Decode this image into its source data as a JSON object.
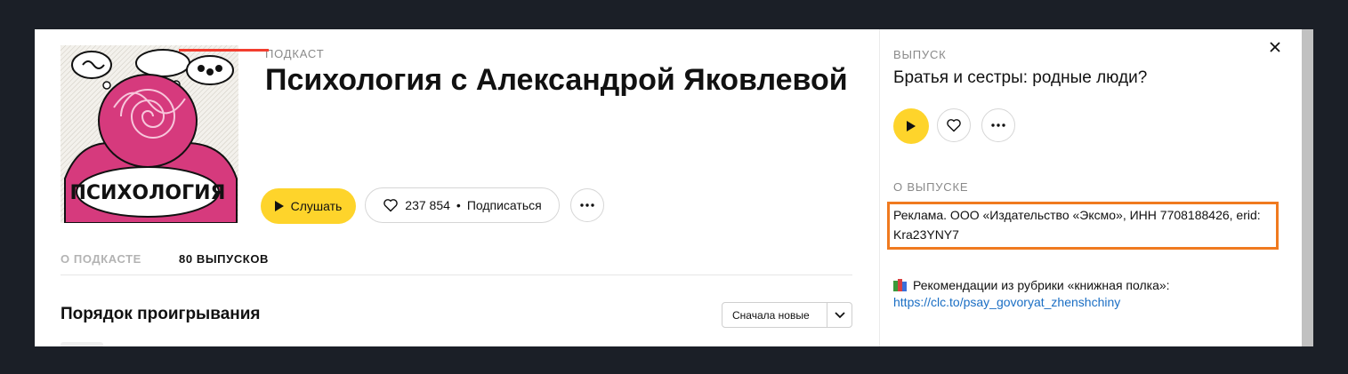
{
  "podcast": {
    "kicker": "ПОДКАСТ",
    "title": "Психология с Александрой Яковлевой",
    "cover_lettering": "ПСИХОЛОГИЯ",
    "listen_label": "Слушать",
    "likes_count": "237 854",
    "separator": "•",
    "subscribe_label": "Подписаться"
  },
  "tabs": [
    {
      "label": "О ПОДКАСТЕ",
      "active": false
    },
    {
      "label": "80 ВЫПУСКОВ",
      "active": true
    }
  ],
  "order": {
    "title": "Порядок проигрывания",
    "sort_value": "Сначала новые"
  },
  "episode_panel": {
    "kicker": "ВЫПУСК",
    "title": "Братья и сестры: родные люди?",
    "about_kicker": "О ВЫПУСКЕ",
    "description": "Реклама. ООО «Издательство «Эксмо», ИНН 7708188426, erid: Kra23YNY7",
    "recommendation": "Рекомендации из рубрики «книжная полка»:",
    "link": "https://clc.to/psay_govoryat_zhenshchiny"
  },
  "colors": {
    "page_background": "#1b1f27",
    "accent_yellow": "#fed42b",
    "tab_underline": "#f23d2e",
    "highlight_border": "#f07a1f",
    "link": "#1a6ec4",
    "cover_pink": "#d63a7d"
  },
  "icons": {
    "play": "play-icon",
    "like": "heart-icon",
    "more": "more-dots-icon",
    "close": "close-icon",
    "sort": "chevron-down-icon",
    "books": "books-emoji-icon"
  }
}
